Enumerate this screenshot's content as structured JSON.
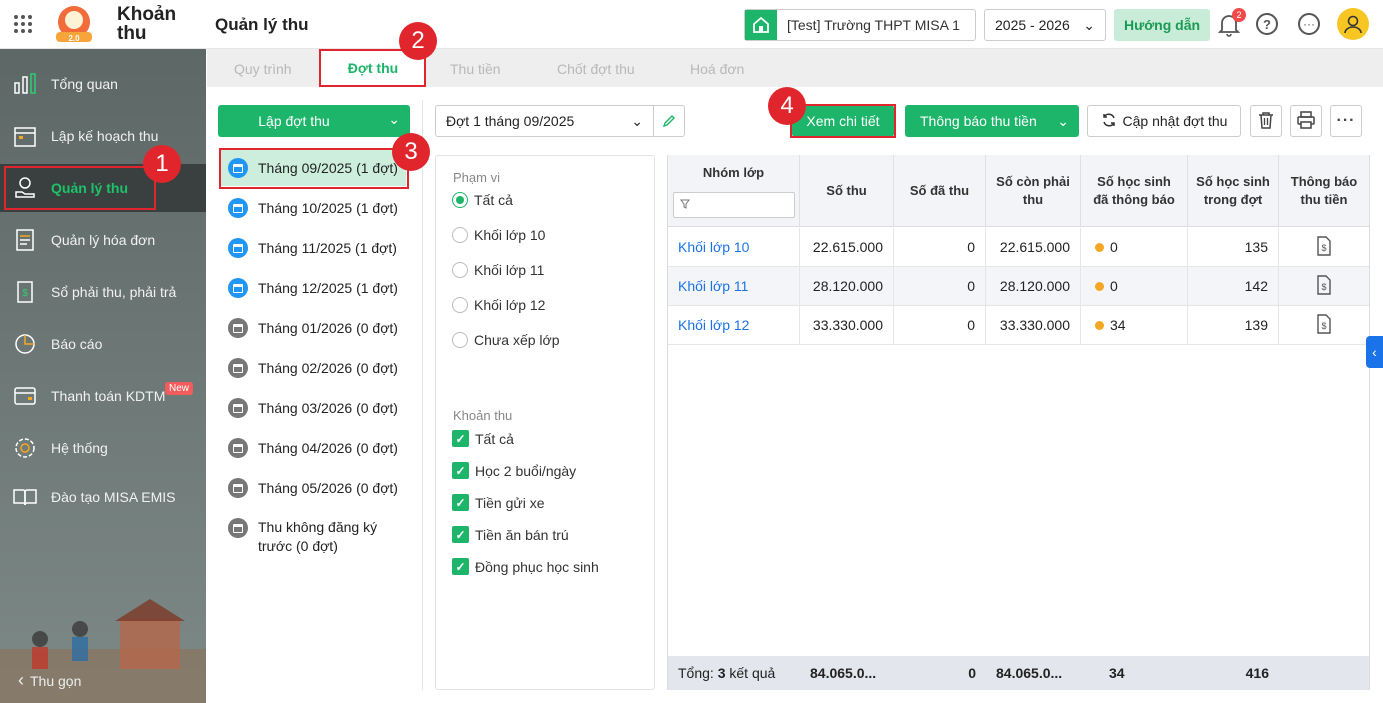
{
  "header": {
    "app_title_line1": "Khoản",
    "app_title_line2": "thu",
    "page_title": "Quản lý thu",
    "school": "[Test] Trường THPT MISA 1",
    "year": "2025 - 2026",
    "guide": "Hướng dẫn",
    "notifications": "2"
  },
  "sidebar": {
    "items": [
      {
        "label": "Tổng quan",
        "icon": "chart-icon"
      },
      {
        "label": "Lập kế hoạch thu",
        "icon": "calendar-icon"
      },
      {
        "label": "Quản lý thu",
        "icon": "hand-coin-icon"
      },
      {
        "label": "Quản lý hóa đơn",
        "icon": "document-icon"
      },
      {
        "label": "Sổ phải thu, phải trả",
        "icon": "book-icon"
      },
      {
        "label": "Báo cáo",
        "icon": "pie-icon"
      },
      {
        "label": "Thanh toán KDTM",
        "icon": "card-icon"
      },
      {
        "label": "Hệ thống",
        "icon": "gear-icon"
      },
      {
        "label": "Đào tạo MISA EMIS",
        "icon": "open-book-icon"
      }
    ],
    "new_tag": "New",
    "collapse": "Thu gọn"
  },
  "tabs": [
    "Quy trình",
    "Đợt thu",
    "Thu tiền",
    "Chốt đợt thu",
    "Hoá đơn"
  ],
  "left": {
    "create_button": "Lập đợt thu",
    "periods": [
      "Tháng 09/2025 (1 đợt)",
      "Tháng 10/2025 (1 đợt)",
      "Tháng 11/2025 (1 đợt)",
      "Tháng 12/2025 (1 đợt)",
      "Tháng 01/2026 (0 đợt)",
      "Tháng 02/2026 (0 đợt)",
      "Tháng 03/2026 (0 đợt)",
      "Tháng 04/2026 (0 đợt)",
      "Tháng 05/2026 (0 đợt)"
    ],
    "unregistered_line1": "Thu không đăng ký",
    "unregistered_line2": "trước (0 đợt)"
  },
  "toolbar": {
    "batch_select": "Đợt 1 tháng 09/2025",
    "view_detail": "Xem chi tiết",
    "notify": "Thông báo thu tiền",
    "update": "Cập nhật đợt thu"
  },
  "filter": {
    "scope_label": "Phạm vi",
    "scope_options": [
      "Tất cả",
      "Khối lớp 10",
      "Khối lớp 11",
      "Khối lớp 12",
      "Chưa xếp lớp"
    ],
    "fee_label": "Khoản thu",
    "fee_options": [
      "Tất cả",
      "Học 2 buổi/ngày",
      "Tiền gửi xe",
      "Tiền ăn bán trú",
      "Đồng phục học sinh"
    ]
  },
  "table": {
    "headers": [
      "Nhóm lớp",
      "Số thu",
      "Số đã thu",
      "Số còn phải thu",
      "Số học sinh đã thông báo",
      "Số học sinh trong đợt",
      "Thông báo thu tiền"
    ],
    "rows": [
      {
        "group": "Khối lớp 10",
        "amount": "22.615.000",
        "paid": "0",
        "remaining": "22.615.000",
        "notified": "0",
        "students": "135"
      },
      {
        "group": "Khối lớp 11",
        "amount": "28.120.000",
        "paid": "0",
        "remaining": "28.120.000",
        "notified": "0",
        "students": "142"
      },
      {
        "group": "Khối lớp 12",
        "amount": "33.330.000",
        "paid": "0",
        "remaining": "33.330.000",
        "notified": "34",
        "students": "139"
      }
    ],
    "footer": {
      "total_prefix": "Tổng:",
      "total_count": "3",
      "total_suffix": "kết quả",
      "amount": "84.065.0...",
      "paid": "0",
      "remaining": "84.065.0...",
      "notified": "34",
      "students": "416"
    }
  },
  "markers": [
    "1",
    "2",
    "3",
    "4"
  ]
}
